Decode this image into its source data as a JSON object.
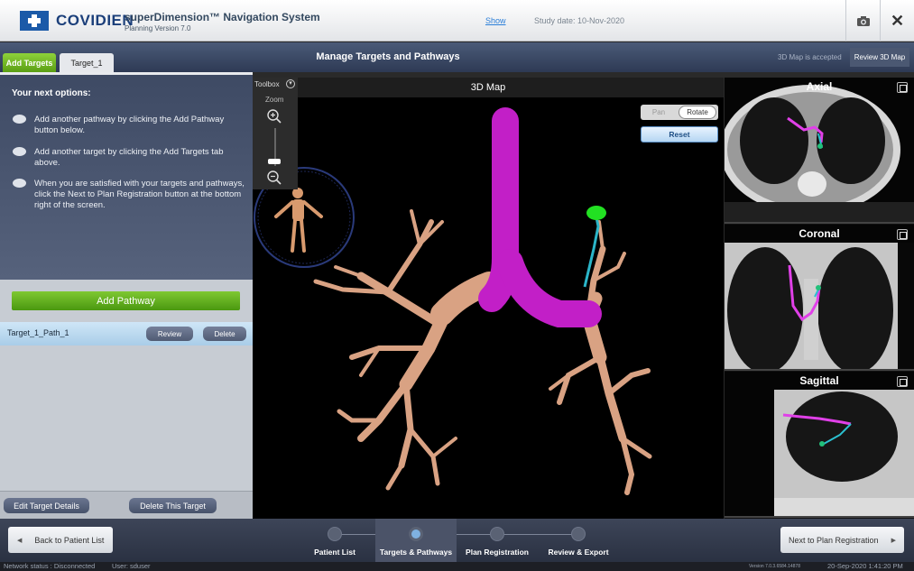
{
  "header": {
    "brand": "COVIDIEN",
    "app_title": "superDimension™ Navigation System",
    "app_subtitle": "Planning Version 7.0",
    "show_link": "Show",
    "study_date": "Study date: 10-Nov-2020",
    "camera_icon": "camera-icon",
    "close_glyph": "✕"
  },
  "nav": {
    "tabs": [
      {
        "label": "Add Targets",
        "active": true
      },
      {
        "label": "Target_1",
        "active": false
      }
    ],
    "title": "Manage Targets and Pathways",
    "accepted_text": "3D Map is accepted",
    "review_button": "Review 3D Map"
  },
  "left_panel": {
    "options_title": "Your next options:",
    "options": [
      "Add another pathway by clicking the Add Pathway button below.",
      "Add another target by clicking the Add Targets tab above.",
      "When you are satisfied with your targets and pathways, click the Next to Plan Registration button at the bottom right of the screen."
    ],
    "add_pathway": "Add Pathway",
    "pathway": {
      "name": "Target_1_Path_1",
      "review": "Review",
      "delete": "Delete"
    },
    "edit_target": "Edit Target Details",
    "delete_target": "Delete This Target"
  },
  "map": {
    "title": "3D Map",
    "toolbox_label": "Toolbox",
    "zoom_label": "Zoom",
    "pan": "Pan",
    "rotate": "Rotate",
    "reset": "Reset",
    "colors": {
      "airway": "#d9a283",
      "trachea": "#c21fc7",
      "target": "#22e022",
      "path": "#2bb5c8"
    }
  },
  "ct_views": [
    {
      "title": "Axial"
    },
    {
      "title": "Coronal"
    },
    {
      "title": "Sagittal"
    }
  ],
  "bottom": {
    "back": "Back to Patient List",
    "next": "Next to Plan Registration",
    "steps": [
      {
        "label": "Patient List",
        "active": false
      },
      {
        "label": "Targets & Pathways",
        "active": true
      },
      {
        "label": "Plan Registration",
        "active": false
      },
      {
        "label": "Review & Export",
        "active": false
      }
    ]
  },
  "status": {
    "network": "Network status : Disconnected",
    "user": "User:  sduser",
    "version": "Version 7.0.3.6584.14878",
    "datetime": "20-Sep-2020 1:41:20 PM"
  }
}
